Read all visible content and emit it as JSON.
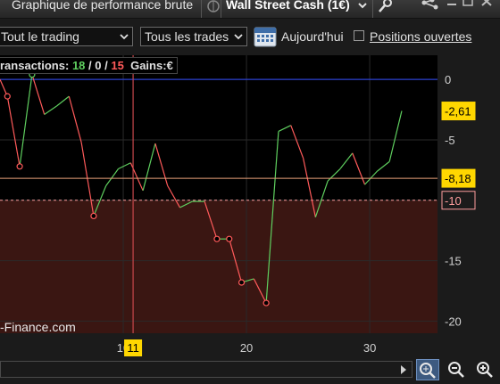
{
  "titlebar": {
    "window_title": "Graphique de performance brute",
    "instrument": "Wall Street Cash (1€)"
  },
  "toolbar": {
    "trading_select": "Tout le trading",
    "trades_select": "Tous les trades",
    "today_label": "Aujourd'hui",
    "positions_label": "Positions ouvertes",
    "positions_checked": false
  },
  "stats": {
    "transactions_label": "ransactions:",
    "wins": "18",
    "sep1": "/",
    "neutral": "0",
    "sep2": "/",
    "losses": "15",
    "gains_label": "Gains:",
    "gains_value": "€"
  },
  "watermark": "-Finance.com",
  "price_tags": {
    "last": "-2,61",
    "crosshair": "-8,18",
    "threshold": "-10",
    "crosshair_x": "11"
  },
  "chart_data": {
    "type": "line",
    "y_ticks": [
      "0",
      "-5",
      "-10",
      "-15",
      "-20"
    ],
    "x_ticks": [
      "10",
      "20",
      "30"
    ],
    "ylim": [
      -21,
      2
    ],
    "xlim": [
      0,
      35.5
    ],
    "grid": true,
    "threshold_line": -10,
    "zero_line": 0,
    "crosshair": {
      "x": 10.8,
      "y": -8.18
    },
    "x": [
      0,
      0.6,
      1.6,
      2.6,
      3.6,
      4.6,
      5.6,
      6.6,
      7.6,
      8.6,
      9.6,
      10.6,
      11.6,
      12.6,
      13.6,
      14.6,
      15.6,
      16.6,
      17.6,
      18.6,
      19.6,
      20.6,
      21.6,
      22.6,
      23.6,
      24.6,
      25.6,
      26.6,
      27.6,
      28.6,
      29.6,
      30.6,
      31.6,
      32.6
    ],
    "values": [
      0,
      -1.4,
      -7.2,
      0.4,
      -2.9,
      -2.2,
      -1.4,
      -5.2,
      -11.3,
      -8.8,
      -7.4,
      -6.9,
      -9.2,
      -5.3,
      -8.8,
      -10.6,
      -10.1,
      -10.1,
      -13.2,
      -13.2,
      -16.8,
      -16.5,
      -18.5,
      -4.3,
      -3.8,
      -6.5,
      -11.4,
      -8.4,
      -7.4,
      -6.1,
      -8.7,
      -7.6,
      -6.8,
      -2.61
    ],
    "markers": [
      {
        "x": 0.6,
        "y": -1.4,
        "result": "loss"
      },
      {
        "x": 1.6,
        "y": -7.2,
        "result": "loss"
      },
      {
        "x": 2.6,
        "y": 0.4,
        "result": "gain"
      },
      {
        "x": 7.6,
        "y": -11.3,
        "result": "loss"
      },
      {
        "x": 17.6,
        "y": -13.2,
        "result": "loss"
      },
      {
        "x": 18.6,
        "y": -13.2,
        "result": "loss"
      },
      {
        "x": 19.6,
        "y": -16.8,
        "result": "loss"
      },
      {
        "x": 21.6,
        "y": -18.5,
        "result": "loss"
      }
    ],
    "colors": {
      "gain": "#5fcf5f",
      "loss": "#ff5a5a",
      "zero_line": "#2a3fd0",
      "threshold_line": "#ff9e9e",
      "crosshair": "#c8484c",
      "below_threshold_fill": "#3a1612",
      "plot_background": "#000000",
      "tag_yellow": "#ffd700"
    }
  }
}
